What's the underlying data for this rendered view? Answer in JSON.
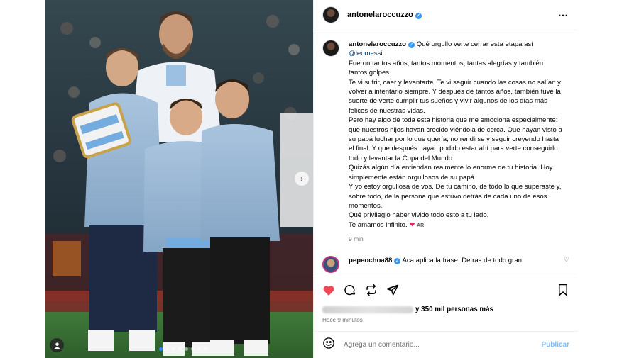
{
  "post": {
    "author": "antonelaroccuzzo",
    "more_icon": "more-horizontal-icon"
  },
  "caption": {
    "author": "antonelaroccuzzo",
    "first_line": "Qué orgullo verte cerrar esta etapa así",
    "mention": "@leomessi",
    "paragraphs": [
      "Fueron tantos años, tantos momentos, tantas alegrías y también tantos golpes.",
      "Te vi sufrir, caer y levantarte. Te vi seguir cuando las cosas no salían y volver a intentarlo siempre. Y después de tantos años, también tuve la suerte de verte cumplir tus sueños y vivir algunos de los días más felices de nuestras vidas.",
      "Pero hay algo de toda esta historia que me emociona especialmente: que nuestros hijos hayan crecido viéndola de cerca. Que hayan visto a su papá luchar por lo que quería, no rendirse y seguir creyendo hasta el final. Y que después hayan podido estar ahí para verte conseguirlo todo y levantar la Copa del Mundo.",
      "Quizás algún día entiendan realmente lo enorme de tu historia. Hoy simplemente están orgullosos de su papá.",
      "Y yo estoy orgullosa de vos. De tu camino, de todo lo que superaste y, sobre todo, de la persona que estuvo detrás de cada uno de esos momentos.",
      "Qué privilegio haber vivido todo esto a tu lado."
    ],
    "closing": "Te amamos infinito.",
    "heart_emoji": "❤",
    "flag": "AR",
    "time": "9 min"
  },
  "reply": {
    "author": "pepeochoa88",
    "text": "Aca aplica la frase: Detras de todo gran"
  },
  "likes": {
    "text": "y 350 mil personas más"
  },
  "posted_ago": "Hace 9 minutos",
  "comment_box": {
    "placeholder": "Agrega un comentario...",
    "publish": "Publicar"
  },
  "colors": {
    "accent": "#0095f6",
    "heart": "#ed4956",
    "mention": "#00376b"
  },
  "carousel": {
    "slides": 8,
    "active": 1
  }
}
